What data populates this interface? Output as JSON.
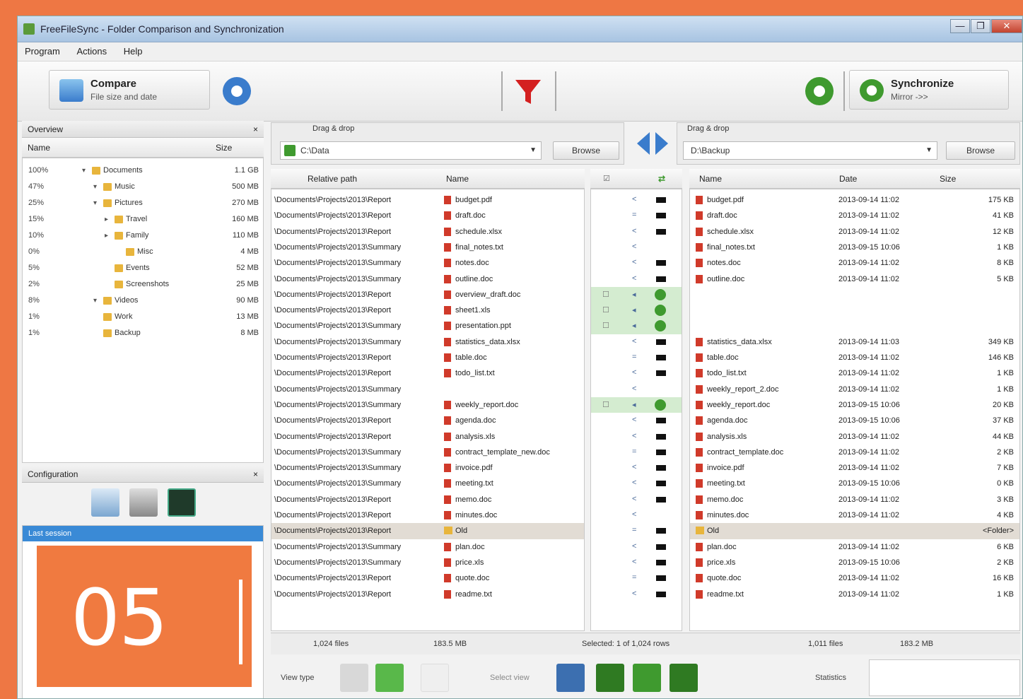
{
  "window": {
    "title": "FreeFileSync - Folder Comparison and Synchronization",
    "controls": [
      "—",
      "❐",
      "✕"
    ]
  },
  "menu": [
    "Program",
    "Actions",
    "Help"
  ],
  "toolbar": {
    "compare": {
      "title": "Compare",
      "subtitle": "File size and date"
    },
    "synchronize": {
      "title": "Synchronize",
      "subtitle": "Mirror ->>"
    }
  },
  "left_panel": {
    "overview_title": "Overview",
    "col_name": "Name",
    "col_size": "Size",
    "tree": [
      {
        "pct": "100%",
        "indent": 0,
        "name": "Documents",
        "size": "1.1 GB",
        "toggle": "▾"
      },
      {
        "pct": "47%",
        "indent": 1,
        "name": "Music",
        "size": "500 MB",
        "toggle": "▾"
      },
      {
        "pct": "25%",
        "indent": 1,
        "name": "Pictures",
        "size": "270 MB",
        "toggle": "▾"
      },
      {
        "pct": "15%",
        "indent": 2,
        "name": "Travel",
        "size": "160 MB",
        "toggle": "▸"
      },
      {
        "pct": "10%",
        "indent": 2,
        "name": "Family",
        "size": "110 MB",
        "toggle": "▸"
      },
      {
        "pct": "0%",
        "indent": 3,
        "name": "Misc",
        "size": "4 MB",
        "toggle": ""
      },
      {
        "pct": "5%",
        "indent": 2,
        "name": "Events",
        "size": "52 MB",
        "toggle": ""
      },
      {
        "pct": "2%",
        "indent": 2,
        "name": "Screenshots",
        "size": "25 MB",
        "toggle": ""
      },
      {
        "pct": "8%",
        "indent": 1,
        "name": "Videos",
        "size": "90 MB",
        "toggle": "▾"
      },
      {
        "pct": "1%",
        "indent": 1,
        "name": "Work",
        "size": "13 MB",
        "toggle": ""
      },
      {
        "pct": "1%",
        "indent": 1,
        "name": "Backup",
        "size": "8 MB",
        "toggle": ""
      }
    ],
    "sync_title": "Configuration",
    "config_item": "Last session"
  },
  "left_pane": {
    "header_label": "Drag & drop",
    "folder": "C:\\Data",
    "browse": "Browse",
    "col_path": "Relative path",
    "col_name": "Name",
    "rows": [
      [
        "\\Documents\\Projects\\2013\\Report",
        "budget.pdf"
      ],
      [
        "\\Documents\\Projects\\2013\\Report",
        "draft.doc"
      ],
      [
        "\\Documents\\Projects\\2013\\Report",
        "schedule.xlsx"
      ],
      [
        "\\Documents\\Projects\\2013\\Summary",
        "final_notes.txt"
      ],
      [
        "\\Documents\\Projects\\2013\\Summary",
        "notes.doc"
      ],
      [
        "\\Documents\\Projects\\2013\\Summary",
        "outline.doc"
      ],
      [
        "\\Documents\\Projects\\2013\\Report",
        "overview_draft.doc"
      ],
      [
        "\\Documents\\Projects\\2013\\Report",
        "sheet1.xls"
      ],
      [
        "\\Documents\\Projects\\2013\\Summary",
        "presentation.ppt"
      ],
      [
        "\\Documents\\Projects\\2013\\Summary",
        "statistics_data.xlsx"
      ],
      [
        "\\Documents\\Projects\\2013\\Report",
        "table.doc"
      ],
      [
        "\\Documents\\Projects\\2013\\Report",
        "todo_list.txt"
      ],
      [
        "\\Documents\\Projects\\2013\\Summary",
        ""
      ],
      [
        "\\Documents\\Projects\\2013\\Summary",
        "weekly_report.doc"
      ],
      [
        "\\Documents\\Projects\\2013\\Report",
        "agenda.doc"
      ],
      [
        "\\Documents\\Projects\\2013\\Report",
        "analysis.xls"
      ],
      [
        "\\Documents\\Projects\\2013\\Summary",
        "contract_template_new.doc"
      ],
      [
        "\\Documents\\Projects\\2013\\Summary",
        "invoice.pdf"
      ],
      [
        "\\Documents\\Projects\\2013\\Summary",
        "meeting.txt"
      ],
      [
        "\\Documents\\Projects\\2013\\Report",
        "memo.doc"
      ],
      [
        "\\Documents\\Projects\\2013\\Report",
        "minutes.doc"
      ],
      [
        "\\Documents\\Projects\\2013\\Report",
        "Old"
      ],
      [
        "\\Documents\\Projects\\2013\\Summary",
        "plan.doc"
      ],
      [
        "\\Documents\\Projects\\2013\\Summary",
        "price.xls"
      ],
      [
        "\\Documents\\Projects\\2013\\Report",
        "quote.doc"
      ],
      [
        "\\Documents\\Projects\\2013\\Report",
        "readme.txt"
      ]
    ],
    "status": [
      "1,024 files",
      "183.5 MB"
    ]
  },
  "right_pane": {
    "header_label": "Drag & drop",
    "folder": "D:\\Backup",
    "browse": "Browse",
    "col_name": "Name",
    "col_date": "Date",
    "col_size": "Size",
    "rows": [
      [
        "budget.pdf",
        "2013-09-14 11:02",
        "175 KB"
      ],
      [
        "draft.doc",
        "2013-09-14 11:02",
        "41 KB"
      ],
      [
        "schedule.xlsx",
        "2013-09-14 11:02",
        "12 KB"
      ],
      [
        "final_notes.txt",
        "2013-09-15 10:06",
        "1 KB"
      ],
      [
        "notes.doc",
        "2013-09-14 11:02",
        "8 KB"
      ],
      [
        "outline.doc",
        "2013-09-14 11:02",
        "5 KB"
      ],
      [
        "",
        "",
        ""
      ],
      [
        "",
        "",
        ""
      ],
      [
        "",
        "",
        ""
      ],
      [
        "statistics_data.xlsx",
        "2013-09-14 11:03",
        "349 KB"
      ],
      [
        "table.doc",
        "2013-09-14 11:02",
        "146 KB"
      ],
      [
        "todo_list.txt",
        "2013-09-14 11:02",
        "1 KB"
      ],
      [
        "weekly_report_2.doc",
        "2013-09-14 11:02",
        "1 KB"
      ],
      [
        "weekly_report.doc",
        "2013-09-15 10:06",
        "20 KB"
      ],
      [
        "agenda.doc",
        "2013-09-15 10:06",
        "37 KB"
      ],
      [
        "analysis.xls",
        "2013-09-14 11:02",
        "44 KB"
      ],
      [
        "contract_template.doc",
        "2013-09-14 11:02",
        "2 KB"
      ],
      [
        "invoice.pdf",
        "2013-09-14 11:02",
        "7 KB"
      ],
      [
        "meeting.txt",
        "2013-09-15 10:06",
        "0 KB"
      ],
      [
        "memo.doc",
        "2013-09-14 11:02",
        "3 KB"
      ],
      [
        "minutes.doc",
        "2013-09-14 11:02",
        "4 KB"
      ],
      [
        "Old",
        "",
        "<Folder>"
      ],
      [
        "plan.doc",
        "2013-09-14 11:02",
        "6 KB"
      ],
      [
        "price.xls",
        "2013-09-15 10:06",
        "2 KB"
      ],
      [
        "quote.doc",
        "2013-09-14 11:02",
        "16 KB"
      ],
      [
        "readme.txt",
        "2013-09-14 11:02",
        "1 KB"
      ]
    ],
    "status": [
      "Selected: 1 of 1,024 rows",
      "1,011 files",
      "183.2 MB"
    ]
  },
  "middle": {
    "states": [
      "<",
      "=",
      "<",
      "<",
      "<",
      "<",
      "◂",
      "◂",
      "◂",
      "<",
      "=",
      "<",
      "<",
      "◂",
      "<",
      "<",
      "=",
      "<",
      "<",
      "<",
      "<",
      "=",
      "<",
      "<",
      "=",
      "<"
    ]
  },
  "bottom": {
    "view_label": "View type",
    "select_label": "Select view",
    "stats_label": "Statistics"
  },
  "badge": {
    "number": "05"
  },
  "colors": {
    "accent": "#f07a40",
    "green": "#3f9a2f",
    "filter_red": "#d42020",
    "blue": "#3a7ccc",
    "select": "#e2dcd4"
  }
}
